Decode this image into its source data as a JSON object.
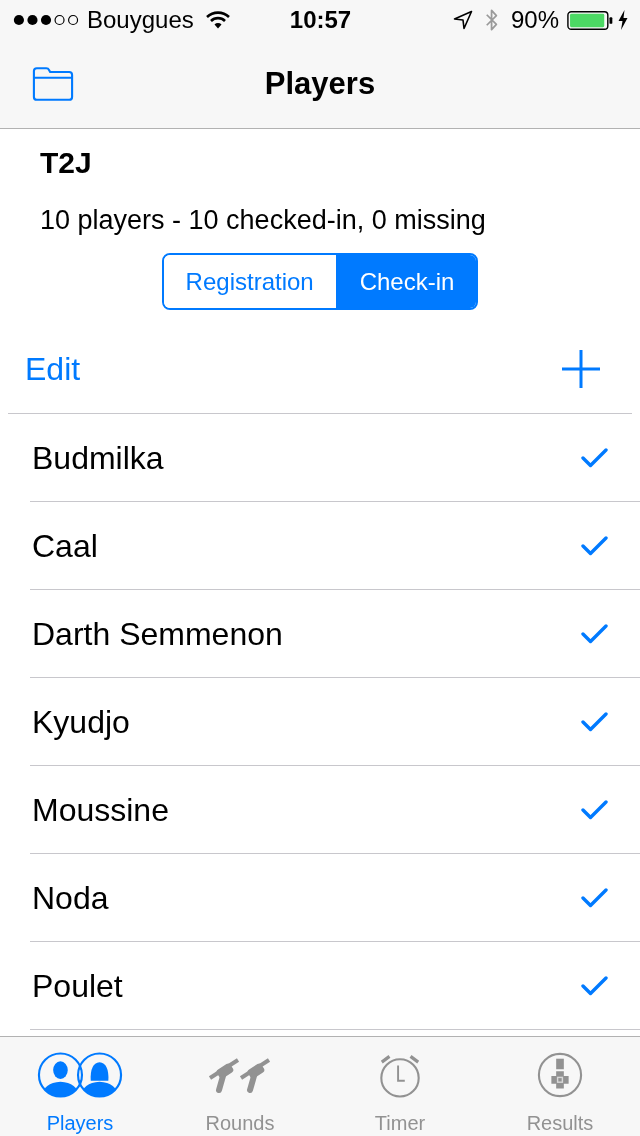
{
  "status_bar": {
    "carrier": "Bouygues",
    "time": "10:57",
    "battery": "90%"
  },
  "nav_bar": {
    "title": "Players"
  },
  "tournament": {
    "name": "T2J",
    "summary": "10 players - 10 checked-in, 0 missing"
  },
  "segments": [
    {
      "label": "Registration",
      "selected": false
    },
    {
      "label": "Check-in",
      "selected": true
    }
  ],
  "toolbar": {
    "edit": "Edit"
  },
  "players": [
    {
      "name": "Budmilka",
      "checked": true
    },
    {
      "name": "Caal",
      "checked": true
    },
    {
      "name": "Darth Semmenon",
      "checked": true
    },
    {
      "name": "Kyudjo",
      "checked": true
    },
    {
      "name": "Moussine",
      "checked": true
    },
    {
      "name": "Noda",
      "checked": true
    },
    {
      "name": "Poulet",
      "checked": true
    }
  ],
  "tab_bar": [
    {
      "label": "Players",
      "kind": "players",
      "selected": true
    },
    {
      "label": "Rounds",
      "kind": "rounds",
      "selected": false
    },
    {
      "label": "Timer",
      "kind": "timer",
      "selected": false
    },
    {
      "label": "Results",
      "kind": "results",
      "selected": false
    }
  ]
}
